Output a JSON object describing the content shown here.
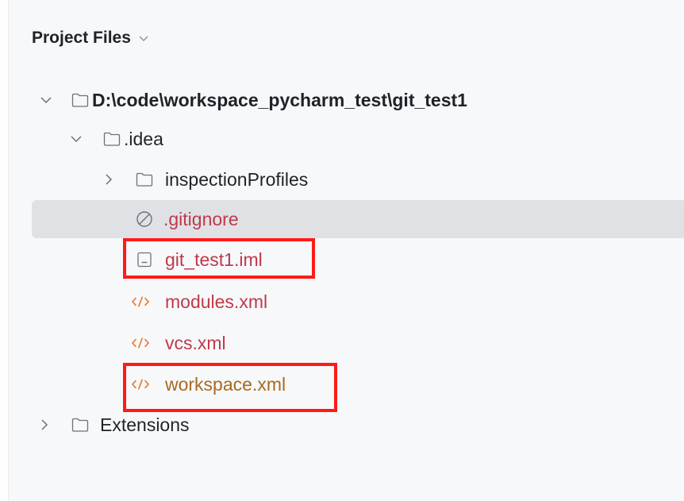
{
  "panel": {
    "title": "Project Files"
  },
  "tree": [
    {
      "id": "root",
      "label": "D:\\code\\workspace_pycharm_test\\git_test1",
      "depth": 0,
      "kind": "folder",
      "state": "expanded",
      "bold": true
    },
    {
      "id": "idea",
      "label": ".idea",
      "depth": 1,
      "kind": "folder",
      "state": "expanded"
    },
    {
      "id": "inspectionProfiles",
      "label": "inspectionProfiles",
      "depth": 2,
      "kind": "folder",
      "state": "collapsed"
    },
    {
      "id": "gitignore",
      "label": ".gitignore",
      "depth": 2,
      "kind": "ignored-file",
      "status_color": "#c0394b",
      "selected": true
    },
    {
      "id": "git_test1_iml",
      "label": "git_test1.iml",
      "depth": 2,
      "kind": "module-file",
      "status_color": "#c0394b",
      "highlighted": true
    },
    {
      "id": "modules_xml",
      "label": "modules.xml",
      "depth": 2,
      "kind": "xml-file",
      "status_color": "#c0394b"
    },
    {
      "id": "vcs_xml",
      "label": "vcs.xml",
      "depth": 2,
      "kind": "xml-file",
      "status_color": "#c0394b"
    },
    {
      "id": "workspace_xml",
      "label": "workspace.xml",
      "depth": 2,
      "kind": "xml-file",
      "status_color": "#a86a1f",
      "highlighted": true
    },
    {
      "id": "extensions",
      "label": "Extensions",
      "depth": 0,
      "kind": "folder",
      "state": "collapsed"
    }
  ],
  "colors": {
    "selection_bg": "#dfe1e5",
    "highlight_box": "#ff1a1a",
    "xml_icon": "#e8782a"
  }
}
